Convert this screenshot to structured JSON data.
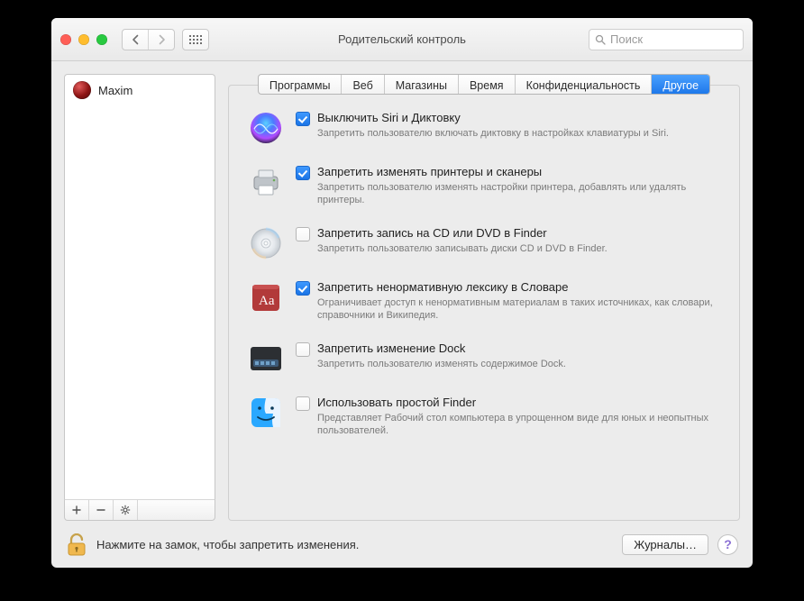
{
  "window": {
    "title": "Родительский контроль"
  },
  "search": {
    "placeholder": "Поиск"
  },
  "sidebar": {
    "users": [
      {
        "name": "Maxim"
      }
    ],
    "buttons": {
      "add": "+",
      "remove": "−",
      "gear": "gear"
    }
  },
  "tabs": {
    "items": [
      {
        "label": "Программы",
        "active": false
      },
      {
        "label": "Веб",
        "active": false
      },
      {
        "label": "Магазины",
        "active": false
      },
      {
        "label": "Время",
        "active": false
      },
      {
        "label": "Конфиденциальность",
        "active": false
      },
      {
        "label": "Другое",
        "active": true
      }
    ]
  },
  "settings": [
    {
      "icon": "siri",
      "checked": true,
      "label": "Выключить Siri и Диктовку",
      "desc": "Запретить пользователю включать диктовку в настройках клавиатуры и Siri."
    },
    {
      "icon": "printer",
      "checked": true,
      "label": "Запретить изменять принтеры и сканеры",
      "desc": "Запретить пользователю изменять настройки принтера, добавлять или удалять принтеры."
    },
    {
      "icon": "disc",
      "checked": false,
      "label": "Запретить запись на CD или DVD в Finder",
      "desc": "Запретить пользователю записывать диски CD и DVD в Finder."
    },
    {
      "icon": "dictionary",
      "checked": true,
      "label": "Запретить ненормативную лексику в Словаре",
      "desc": "Ограничивает доступ к ненормативным материалам в таких источниках, как словари, справочники и Википедия."
    },
    {
      "icon": "dock",
      "checked": false,
      "label": "Запретить изменение Dock",
      "desc": "Запретить пользователю изменять содержимое Dock."
    },
    {
      "icon": "finder",
      "checked": false,
      "label": "Использовать простой Finder",
      "desc": "Представляет Рабочий стол компьютера в упрощенном виде для юных и неопытных пользователей."
    }
  ],
  "footer": {
    "lock_text": "Нажмите на замок, чтобы запретить изменения.",
    "logs_button": "Журналы…",
    "help": "?"
  }
}
